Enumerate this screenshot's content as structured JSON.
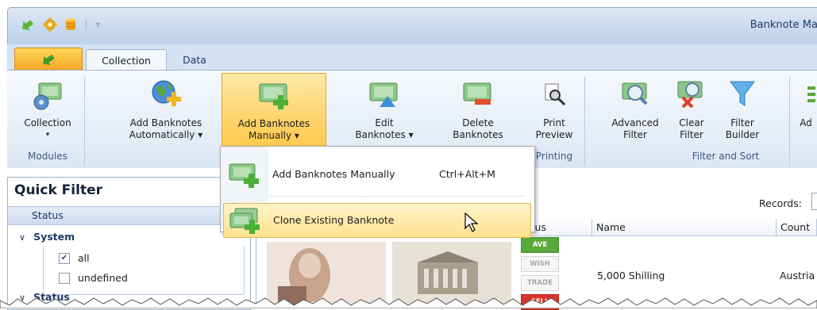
{
  "window": {
    "title": "Banknote Ma"
  },
  "tabs": {
    "collection": "Collection",
    "data": "Data"
  },
  "ribbon": {
    "collection": "Collection",
    "add_auto": [
      "Add Banknotes",
      "Automatically ▾"
    ],
    "add_manual": [
      "Add Banknotes",
      "Manually ▾"
    ],
    "edit": [
      "Edit",
      "Banknotes ▾"
    ],
    "delete": [
      "Delete",
      "Banknotes"
    ],
    "print": [
      "Print",
      "Preview"
    ],
    "advanced": [
      "Advanced",
      "Filter"
    ],
    "clear": [
      "Clear",
      "Filter"
    ],
    "builder": [
      "Filter",
      "Builder"
    ],
    "cut": "Ad",
    "groups": {
      "modules": "Modules",
      "printing": "Printing",
      "filter_sort": "Filter and Sort"
    }
  },
  "menu": {
    "items": [
      {
        "label": "Add Banknotes Manually",
        "shortcut": "Ctrl+Alt+M"
      },
      {
        "label": "Clone Existing Banknote",
        "shortcut": ""
      }
    ]
  },
  "quick_filter": {
    "title": "Quick Filter",
    "section": "Status",
    "system_group": "System",
    "items": [
      {
        "label": "all",
        "checked": true
      },
      {
        "label": "undefined",
        "checked": false
      }
    ],
    "status_group": "Status"
  },
  "grid": {
    "records_label": "Records:",
    "columns": [
      "Status",
      "Name",
      "Count"
    ],
    "columns_visible": [
      "atus",
      "Name",
      "Count"
    ],
    "row": {
      "name": "5,000 Shilling",
      "country": "Austria"
    },
    "badges": [
      "HAVE",
      "WISH",
      "TRADE",
      "SELL"
    ],
    "badges_visible": [
      "AVE",
      "WISH",
      "TRADE",
      "SELL"
    ]
  },
  "colors": {
    "accent": "#f5a623",
    "ribbon": "#e7eef8",
    "hover": "#ffe18e",
    "have": "#59a83a",
    "sell": "#d9342b"
  }
}
